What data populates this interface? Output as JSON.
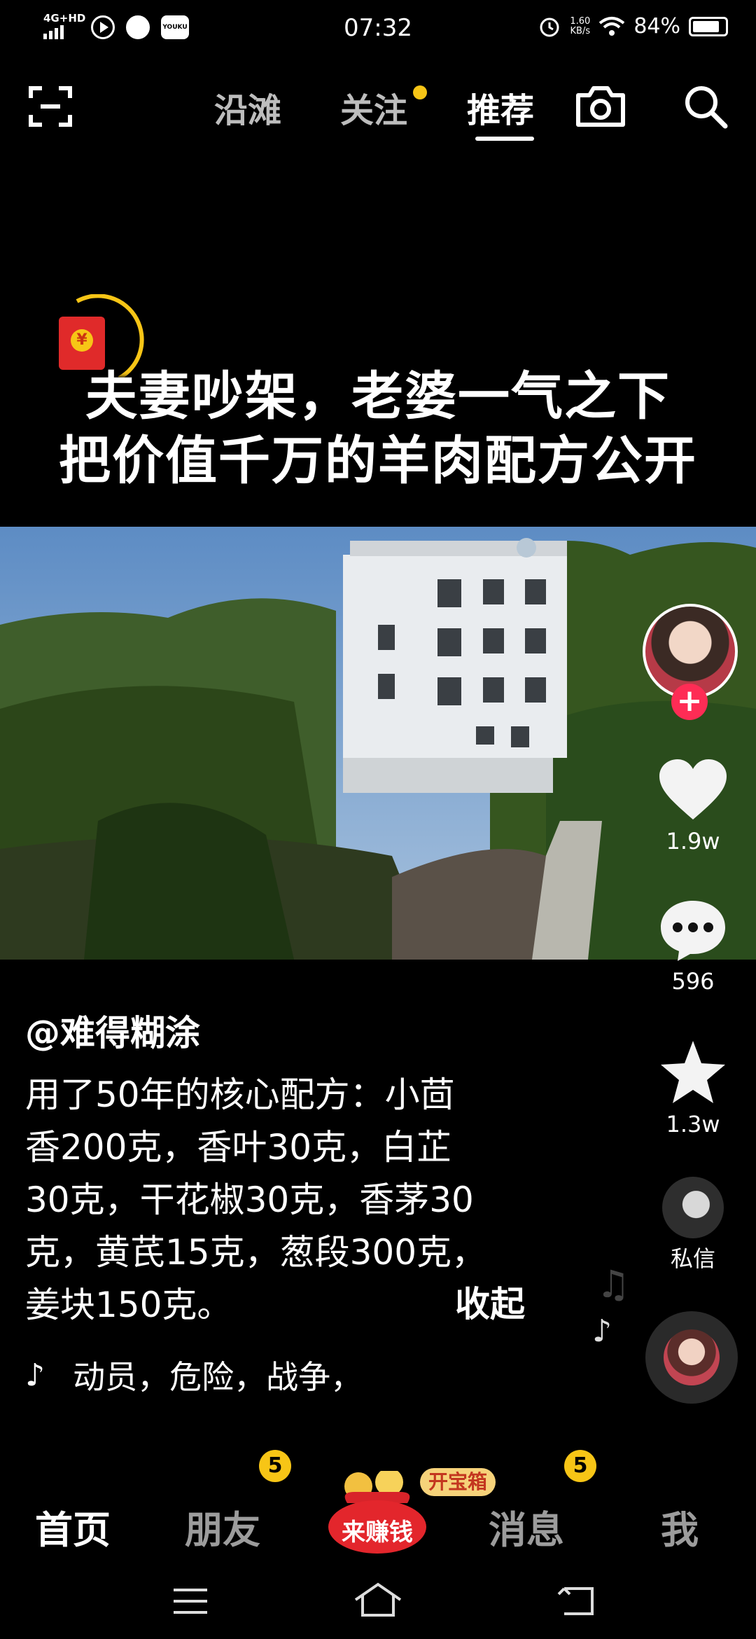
{
  "status_bar": {
    "network": "4G+HD",
    "time": "07:32",
    "speed": "1.60",
    "speed_unit": "KB/s",
    "battery": "84%",
    "battery_level": 0.84
  },
  "top_nav": {
    "tabs": [
      {
        "label": "沿滩"
      },
      {
        "label": "关注"
      },
      {
        "label": "推荐"
      }
    ],
    "active": "推荐"
  },
  "video": {
    "headline_line1": "夫妻吵架，老婆一气之下",
    "headline_line2": "把价值千万的羊肉配方公开",
    "redpack_symbol": "¥"
  },
  "sidebar": {
    "like_count": "1.9w",
    "comment_count": "596",
    "favorite_count": "1.3w",
    "dm_label": "私信"
  },
  "post": {
    "author": "@难得糊涂",
    "description_lines": [
      "用了50年的核心配方：小茴",
      "香200克，香叶30克，白芷",
      "30克，干花椒30克，香茅30",
      "克，黄芪15克，葱段300克，",
      "姜块150克。"
    ],
    "collapse_label": "收起",
    "music_tags": "动员，危险，战争，"
  },
  "bottom_nav": {
    "home": "首页",
    "friends": "朋友",
    "friends_badge": "5",
    "earn": "来赚钱",
    "treasure": "开宝箱",
    "messages": "消息",
    "messages_badge": "5",
    "me": "我"
  },
  "colors": {
    "accent_yellow": "#f7c516",
    "follow_red": "#fe2c55",
    "sky": "#6d98c9",
    "foliage": "#2f4a1e"
  }
}
